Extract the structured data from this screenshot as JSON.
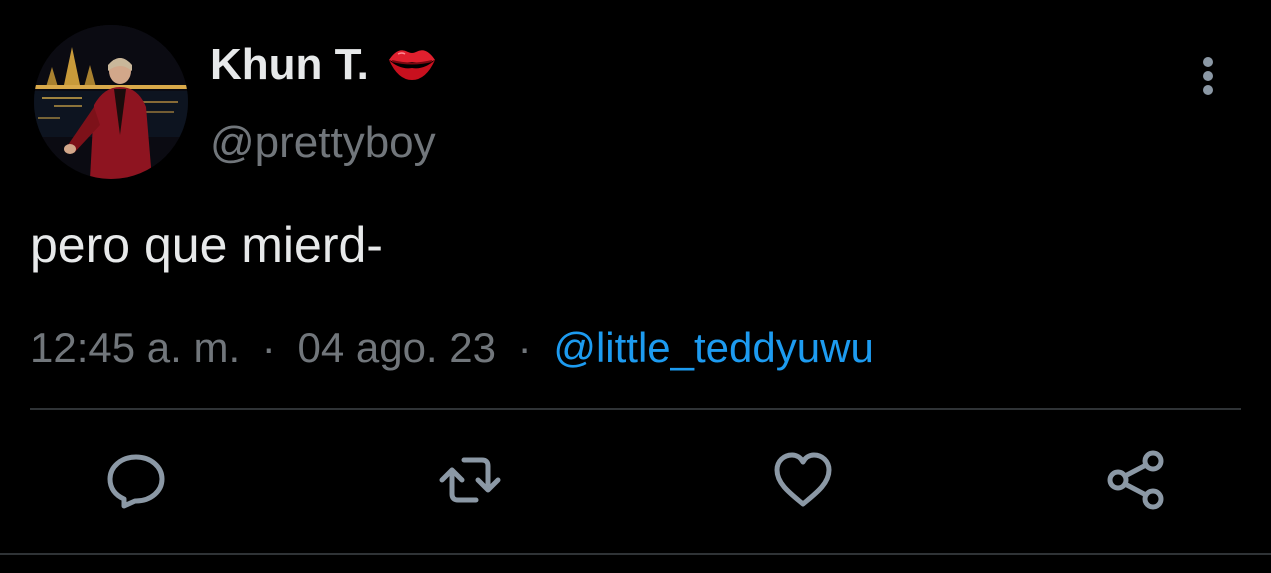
{
  "tweet": {
    "display_name": "Khun T.",
    "handle": "@prettyboy",
    "text": "pero que mierd-",
    "time": "12:45 a. m.",
    "date": "04 ago. 23",
    "separator": "·",
    "source": "@little_teddyuwu"
  },
  "icons": {
    "name_emoji": "lips-icon",
    "more": "more-vertical-icon",
    "reply": "reply-icon",
    "retweet": "retweet-icon",
    "like": "heart-icon",
    "share": "share-icon"
  },
  "colors": {
    "background": "#000000",
    "text_primary": "#e7e9ea",
    "text_secondary": "#71767b",
    "link": "#1d9bf0",
    "divider": "#2f3336",
    "icon": "#8b98a5"
  }
}
